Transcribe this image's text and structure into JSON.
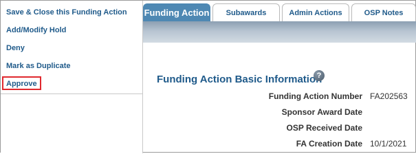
{
  "actions": [
    {
      "label": "Save & Close this Funding Action"
    },
    {
      "label": "Add/Modify Hold"
    },
    {
      "label": "Deny"
    },
    {
      "label": "Mark as Duplicate"
    },
    {
      "label": "Approve"
    }
  ],
  "tabs": [
    {
      "label": "Funding Action",
      "active": true
    },
    {
      "label": "Subawards"
    },
    {
      "label": "Admin Actions"
    },
    {
      "label": "OSP Notes"
    }
  ],
  "section": {
    "title": "Funding Action Basic Information",
    "help_icon": "?"
  },
  "fields": [
    {
      "label": "Funding Action Number",
      "value": "FA202563"
    },
    {
      "label": "Sponsor Award Date",
      "value": ""
    },
    {
      "label": "OSP Received Date",
      "value": ""
    },
    {
      "label": "FA Creation Date",
      "value": "10/1/2021"
    }
  ],
  "colors": {
    "link": "#1f5a8a",
    "active_tab": "#4e88b3",
    "highlight": "#e0282e"
  }
}
